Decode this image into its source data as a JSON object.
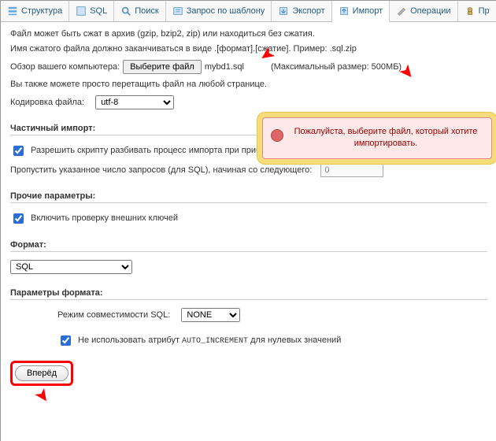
{
  "tabs": {
    "structure": "Структура",
    "sql": "SQL",
    "search": "Поиск",
    "query": "Запрос по шаблону",
    "export": "Экспорт",
    "import": "Импорт",
    "operations": "Операции",
    "privileges": "Пр"
  },
  "intro": {
    "line1": "Файл может быть сжат в архив (gzip, bzip2, zip) или находиться без сжатия.",
    "line2": "Имя сжатого файла должно заканчиваться в виде .[формат].[сжатие]. Пример: .sql.zip"
  },
  "browse": {
    "label": "Обзор вашего компьютера:",
    "button": "Выберите файл",
    "filename": "mybd1.sql",
    "maxsize": "(Максимальный размер: 500МБ)"
  },
  "drag_hint": "Вы также можете просто перетащить файл на любой странице.",
  "encoding": {
    "label": "Кодировка файла:",
    "value": "utf-8"
  },
  "partial": {
    "title": "Частичный импорт:",
    "allow": "Разрешить скрипту разбивать процесс импорта при прибли",
    "skip_label": "Пропустить указанное число запросов (для SQL), начиная со следующего:",
    "skip_value": "0"
  },
  "other": {
    "title": "Прочие параметры:",
    "fk": "Включить проверку внешних ключей"
  },
  "format": {
    "title": "Формат:",
    "value": "SQL"
  },
  "format_params": {
    "title": "Параметры формата:",
    "compat_label": "Режим совместимости SQL:",
    "compat_value": "NONE",
    "noauto_pre": "Не использовать атрибут ",
    "noauto_code": "AUTO_INCREMENT",
    "noauto_post": " для нулевых значений"
  },
  "go": "Вперёд",
  "notice": "Пожалуйста, выберите файл, который хотите импортировать."
}
